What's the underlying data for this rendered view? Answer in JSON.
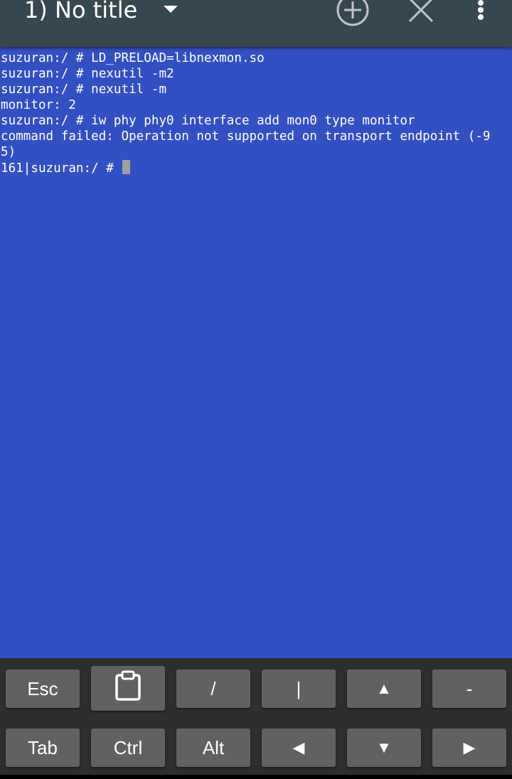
{
  "app": {
    "session_title": "1) No title"
  },
  "toolbar": {
    "icons": [
      "chevron-down-icon",
      "add-circle-icon",
      "close-icon",
      "more-vertical-icon"
    ]
  },
  "terminal": {
    "lines": [
      "suzuran:/ # LD_PRELOAD=libnexmon.so",
      "suzuran:/ # nexutil -m2",
      "suzuran:/ # nexutil -m",
      "monitor: 2",
      "suzuran:/ # iw phy phy0 interface add mon0 type monitor",
      "command failed: Operation not supported on transport endpoint (-9",
      "5)"
    ],
    "prompt": "161|suzuran:/ # ",
    "colors": {
      "background": "#3350c2",
      "foreground": "#ffffff",
      "cursor": "#a0a0a0"
    }
  },
  "keyboard": {
    "row1": {
      "esc": "Esc",
      "paste": "",
      "slash": "/",
      "pipe": "|",
      "up": "▲",
      "dash": "-"
    },
    "row2": {
      "tab": "Tab",
      "ctrl": "Ctrl",
      "alt": "Alt",
      "left": "◀",
      "down": "▼",
      "right": "▶"
    }
  }
}
